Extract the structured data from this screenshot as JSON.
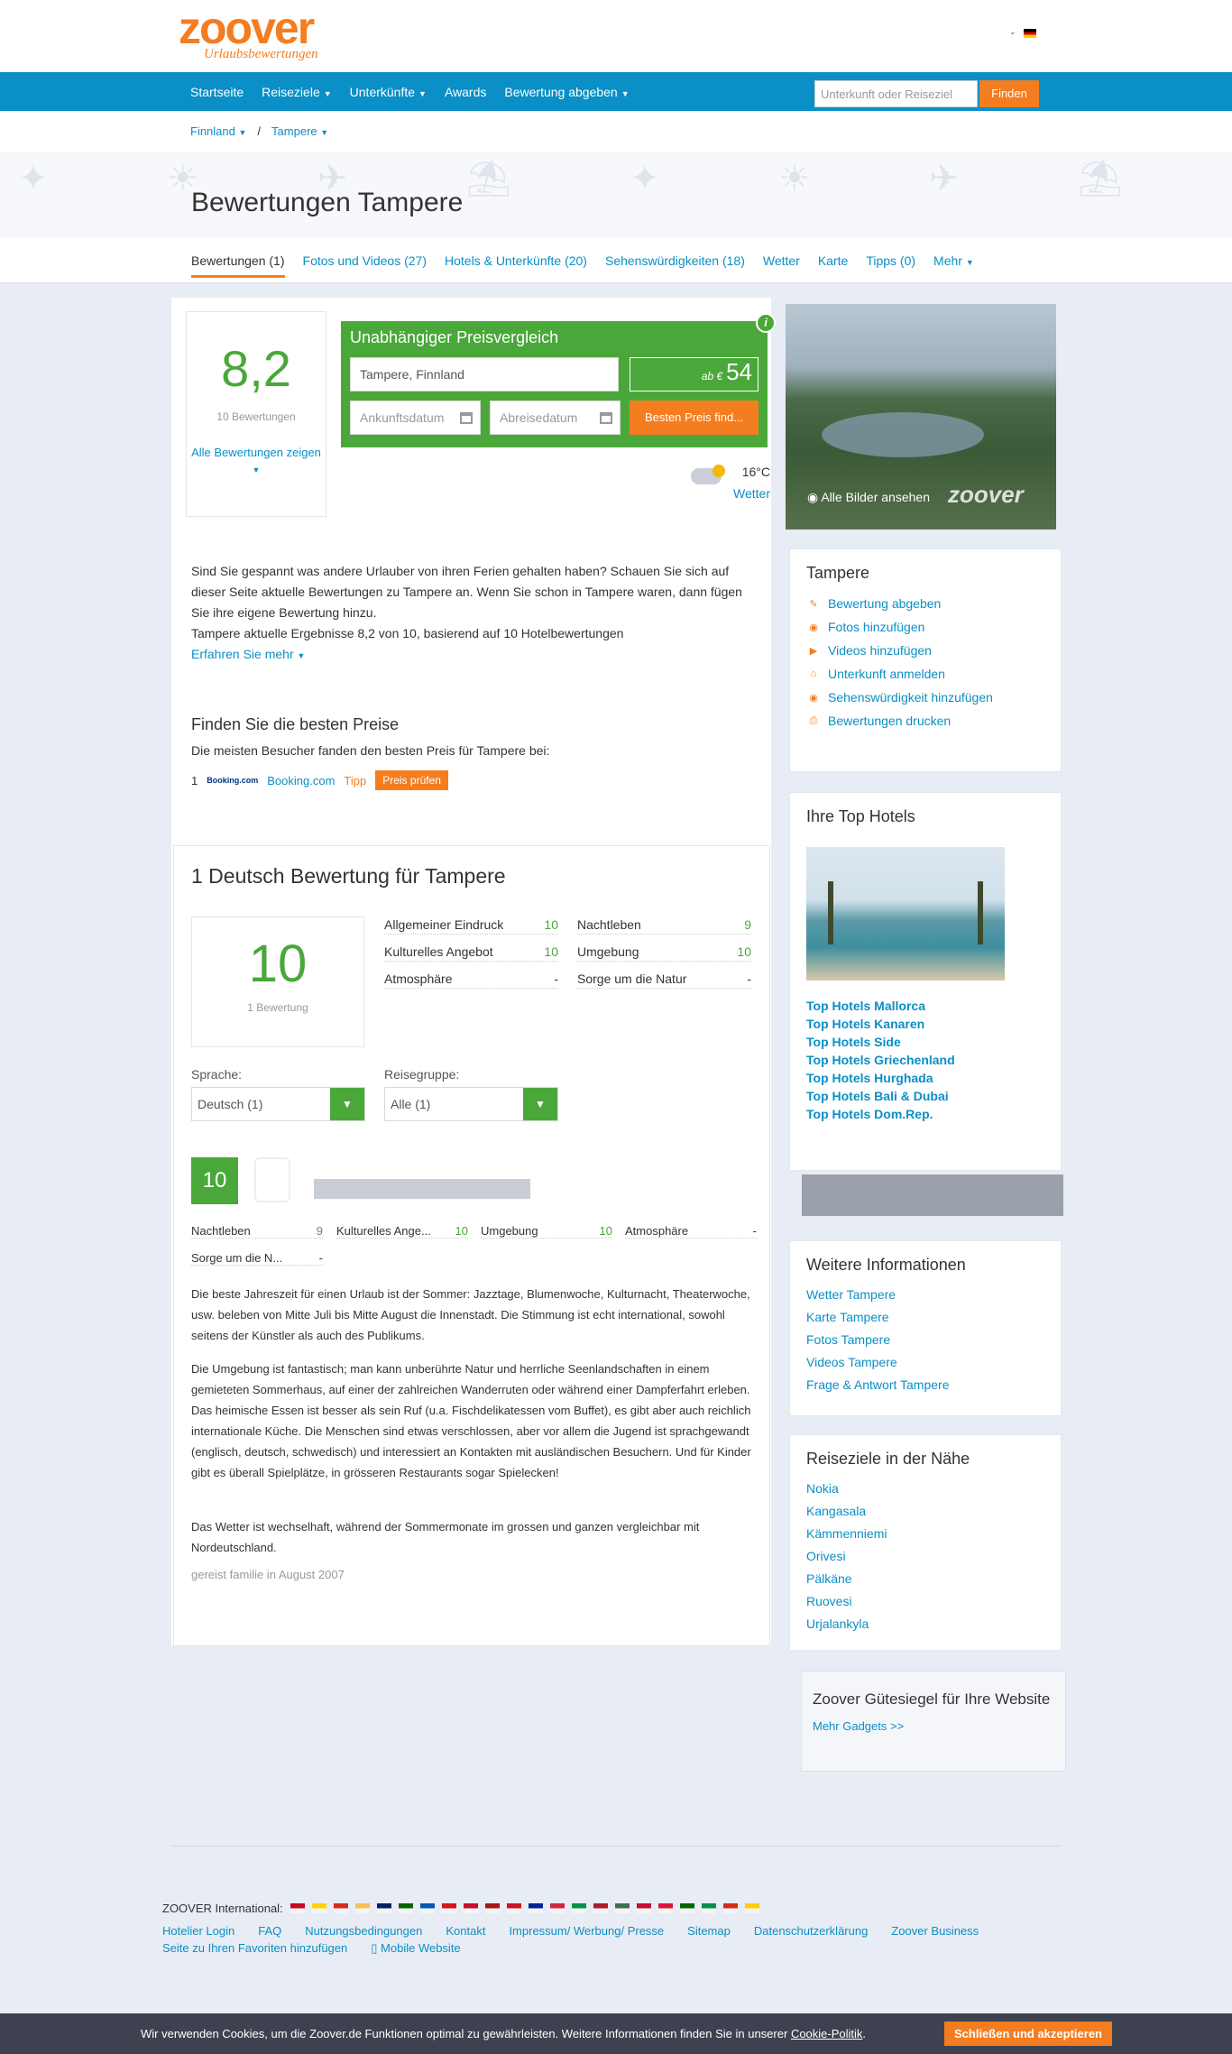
{
  "brand": {
    "logo": "zoover",
    "tagline": "Urlaubsbewertungen"
  },
  "nav": {
    "items": [
      "Startseite",
      "Reiseziele",
      "Unterkünfte",
      "Awards",
      "Bewertung abgeben"
    ],
    "search_placeholder": "Unterkunft oder Reiseziel",
    "search_button": "Finden"
  },
  "breadcrumb": {
    "country": "Finnland",
    "separator": "/",
    "city": "Tampere"
  },
  "page": {
    "title": "Bewertungen Tampere"
  },
  "tabs": [
    "Bewertungen (1)",
    "Fotos und Videos (27)",
    "Hotels & Unterkünfte (20)",
    "Sehenswürdigkeiten (18)",
    "Wetter",
    "Karte",
    "Tipps (0)",
    "Mehr"
  ],
  "score": {
    "value": "8,2",
    "count": "10 Bewertungen",
    "link": "Alle Bewertungen zeigen"
  },
  "price_compare": {
    "title": "Unabhängiger Preisvergleich",
    "destination": "Tampere, Finnland",
    "from_label": "ab €",
    "from_price": "54",
    "arrival_placeholder": "Ankunftsdatum",
    "departure_placeholder": "Abreisedatum",
    "button": "Besten Preis find..."
  },
  "weather": {
    "temp": "16°C",
    "link": "Wetter"
  },
  "photo": {
    "all_link": "Alle Bilder ansehen",
    "watermark": "zoover"
  },
  "intro": {
    "text": "Sind Sie gespannt was andere Urlauber von ihren Ferien gehalten haben? Schauen Sie sich auf dieser Seite aktuelle Bewertungen zu Tampere an. Wenn Sie schon in Tampere waren, dann fügen Sie ihre eigene Bewertung hinzu.",
    "result": "Tampere aktuelle Ergebnisse 8,2 von 10, basierend auf 10 Hotelbewertungen",
    "more": "Erfahren Sie mehr"
  },
  "best_prices": {
    "title": "Finden Sie die besten Preise",
    "subtitle": "Die meisten Besucher fanden den besten Preis für Tampere bei:",
    "rank": "1",
    "provider_logo": "Booking.com",
    "provider": "Booking.com",
    "tip": "Tipp",
    "button": "Preis prüfen"
  },
  "reviews": {
    "title": "1 Deutsch Bewertung für Tampere",
    "overall": "10",
    "overall_count": "1 Bewertung",
    "criteria": [
      {
        "label": "Allgemeiner Eindruck",
        "value": "10"
      },
      {
        "label": "Nachtleben",
        "value": "9"
      },
      {
        "label": "Kulturelles Angebot",
        "value": "10"
      },
      {
        "label": "Umgebung",
        "value": "10"
      },
      {
        "label": "Atmosphäre",
        "value": "-"
      },
      {
        "label": "Sorge um die Natur",
        "value": "-"
      }
    ],
    "lang_label": "Sprache:",
    "lang_value": "Deutsch (1)",
    "group_label": "Reisegruppe:",
    "group_value": "Alle (1)"
  },
  "review": {
    "score": "10",
    "criteria": [
      {
        "label": "Nachtleben",
        "value": "9"
      },
      {
        "label": "Kulturelles Ange...",
        "value": "10"
      },
      {
        "label": "Umgebung",
        "value": "10"
      },
      {
        "label": "Atmosphäre",
        "value": "-"
      },
      {
        "label": "Sorge um die N...",
        "value": "-"
      }
    ],
    "p1": "Die beste Jahreszeit für einen Urlaub ist der Sommer: Jazztage, Blumenwoche, Kulturnacht, Theaterwoche, usw. beleben von Mitte Juli bis Mitte August die Innenstadt. Die Stimmung ist echt international, sowohl seitens der Künstler als auch des Publikums.",
    "p2": "Die Umgebung ist fantastisch; man kann unberührte Natur und herrliche Seenlandschaften in einem gemieteten Sommerhaus, auf einer der zahlreichen Wanderruten oder während einer Dampferfahrt erleben. Das heimische Essen ist besser als sein Ruf (u.a. Fischdelikatessen vom Buffet), es gibt aber auch reichlich internationale Küche. Die Menschen sind etwas verschlossen, aber vor allem die Jugend ist sprachgewandt (englisch, deutsch, schwedisch) und interessiert an Kontakten mit ausländischen Besuchern. Und für Kinder gibt es überall Spielplätze, in grösseren Restaurants sogar Spielecken!",
    "p3": "Das Wetter ist wechselhaft, während der Sommermonate im grossen und ganzen vergleichbar mit Nordeutschland.",
    "meta": "gereist familie in August 2007"
  },
  "sidebar": {
    "actions_title": "Tampere",
    "actions": [
      {
        "icon": "pencil-icon",
        "label": "Bewertung abgeben"
      },
      {
        "icon": "camera-icon",
        "label": "Fotos hinzufügen"
      },
      {
        "icon": "video-icon",
        "label": "Videos hinzufügen"
      },
      {
        "icon": "home-icon",
        "label": "Unterkunft anmelden"
      },
      {
        "icon": "eye-icon",
        "label": "Sehenswürdigkeit hinzufügen"
      },
      {
        "icon": "print-icon",
        "label": "Bewertungen drucken"
      }
    ],
    "top_hotels_title": "Ihre Top Hotels",
    "top_hotels": [
      "Top Hotels Mallorca",
      "Top Hotels Kanaren",
      "Top Hotels Side",
      "Top Hotels Griechenland",
      "Top Hotels Hurghada",
      "Top Hotels Bali & Dubai",
      "Top Hotels Dom.Rep."
    ],
    "more_info_title": "Weitere Informationen",
    "more_info": [
      "Wetter Tampere",
      "Karte Tampere",
      "Fotos Tampere",
      "Videos Tampere",
      "Frage & Antwort Tampere"
    ],
    "nearby_title": "Reiseziele in der Nähe",
    "nearby": [
      "Nokia",
      "Kangasala",
      "Kämmenniemi",
      "Orivesi",
      "Pälkäne",
      "Ruovesi",
      "Urjalankyla"
    ],
    "gadget_title": "Zoover Gütesiegel für Ihre Website",
    "gadget_link": "Mehr Gadgets >>"
  },
  "footer": {
    "intl_label": "ZOOVER International:",
    "flag_colors": [
      "#c60b1e",
      "#ffd200",
      "#d52b1e",
      "#f2c34f",
      "#012169",
      "#006600",
      "#0057b7",
      "#d7141a",
      "#c60c30",
      "#aa151b",
      "#ce1126",
      "#002395",
      "#ce2939",
      "#009246",
      "#ae1c28",
      "#436f4d",
      "#c60c30",
      "#dc143c",
      "#006600",
      "#009246",
      "#d52b1e",
      "#ffce00"
    ],
    "links": [
      "Hotelier Login",
      "FAQ",
      "Nutzungsbedingungen",
      "Kontakt",
      "Impressum/ Werbung/ Presse",
      "Sitemap",
      "Datenschutzerklärung",
      "Zoover Business",
      "Seite zu Ihren Favoriten hinzufügen",
      "Mobile Website"
    ]
  },
  "cookie": {
    "text": "Wir verwenden Cookies, um die Zoover.de Funktionen optimal zu gewährleisten. Weitere Informationen finden Sie in unserer",
    "policy": "Cookie-Politik",
    "button": "Schließen und akzeptieren"
  },
  "colors": {
    "brand_orange": "#f47d20",
    "nav_blue": "#0a8fc6",
    "score_green": "#4aa83a",
    "cookie_bg": "#3e4250"
  }
}
